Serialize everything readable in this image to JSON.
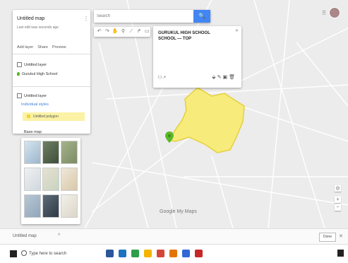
{
  "map_title": "Untitled map",
  "map_subtitle": "Last edit was seconds ago",
  "layer_actions": [
    "Add layer",
    "Share",
    "Preview"
  ],
  "layers": {
    "first_layer": "Untitled layer",
    "first_item": "Gurukul High School",
    "second_layer": "Untitled layer",
    "style_link": "Individual styles",
    "polygon_item": "Untitled polygon"
  },
  "base_map_label": "Base map",
  "search": {
    "placeholder": "Search",
    "button_label": "🔍"
  },
  "info_card": {
    "title": "GURUKUL HIGH SCHOOL SCHOOL — TOP",
    "description": "",
    "footer_left": "☐ ↗"
  },
  "map_labels": {
    "place": "",
    "terrain": "",
    "google": "Google My Maps",
    "attribution": ""
  },
  "bottom_bar": {
    "tab_text": "Untitled map",
    "button": "Done"
  },
  "taskbar": {
    "search_text": "Type here to search",
    "tray_text": "",
    "clock_time": "",
    "clock_date": ""
  },
  "colors": {
    "polygon_fill": "#f7ec7b",
    "polygon_stroke": "#e6cf3a",
    "pin": "#5bb82a",
    "search_button": "#4285f4"
  }
}
